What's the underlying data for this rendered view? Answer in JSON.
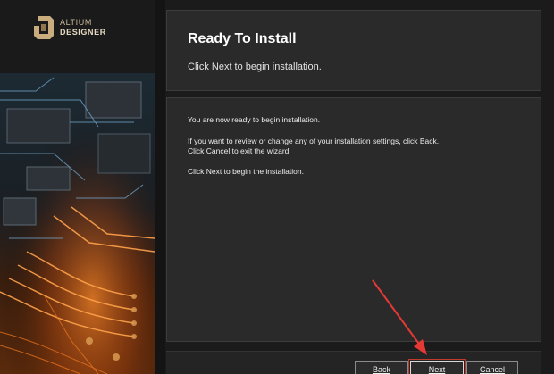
{
  "brand": {
    "logo_line1": "ALTIUM",
    "logo_line2": "DESIGNER",
    "logo_icon": "altium-a-logo-icon",
    "accent_color": "#b89a6a"
  },
  "header": {
    "title": "Ready To Install",
    "subtitle": "Click Next to begin installation."
  },
  "content": {
    "paragraphs": [
      "You are now ready to begin installation.",
      "If you want to review or change any of your installation settings, click Back.",
      "Click Cancel to exit the wizard.",
      "Click Next to begin the installation."
    ]
  },
  "buttons": {
    "back": "Back",
    "next": "Next",
    "cancel": "Cancel"
  },
  "annotation": {
    "arrow_color": "#e53935",
    "highlight_color": "#c0392b"
  }
}
